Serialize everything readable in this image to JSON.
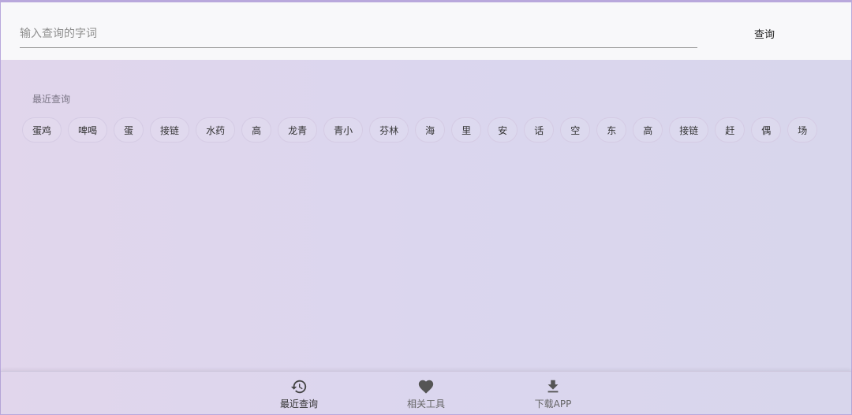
{
  "search": {
    "placeholder": "输入查询的字词",
    "button_label": "查询"
  },
  "recent": {
    "title": "最近查询",
    "items": [
      "蛋鸡",
      "啤喝",
      "蛋",
      "接链",
      "水药",
      "高",
      "龙青",
      "青小",
      "芬林",
      "海",
      "里",
      "安",
      "话",
      "空",
      "东",
      "高",
      "接链",
      "赶",
      "偶",
      "场"
    ]
  },
  "bottom_nav": {
    "items": [
      {
        "label": "最近查询",
        "icon": "history-icon",
        "active": true
      },
      {
        "label": "相关工具",
        "icon": "heart-icon",
        "active": false
      },
      {
        "label": "下载APP",
        "icon": "download-icon",
        "active": false
      }
    ]
  },
  "colors": {
    "accent_border": "#b9a8dc",
    "icon_color": "#555555"
  }
}
